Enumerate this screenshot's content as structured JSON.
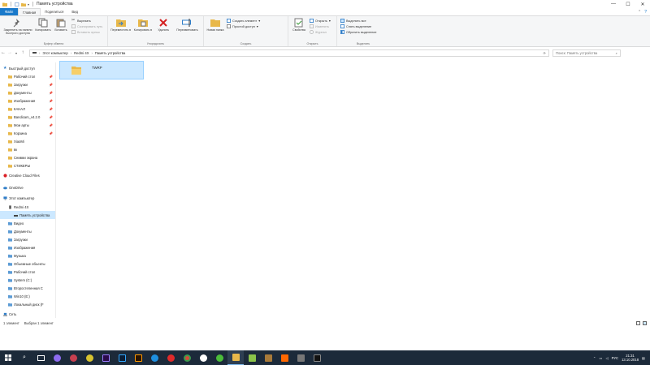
{
  "window": {
    "title": "Память устройства",
    "controls": [
      "—",
      "☐",
      "✕"
    ]
  },
  "ribbon_tabs": {
    "file": "Файл",
    "home": "Главная",
    "share": "Поделиться",
    "view": "Вид"
  },
  "ribbon": {
    "clipboard": {
      "label": "Буфер обмена",
      "pin": "Закрепить на панели быстрого доступа",
      "copy": "Копировать",
      "paste": "Вставить",
      "cut": "Вырезать",
      "copy_path": "Скопировать путь",
      "paste_shortcut": "Вставить ярлык"
    },
    "organize": {
      "label": "Упорядочить",
      "move_to": "Переместить в",
      "copy_to": "Копировать в",
      "delete": "Удалить",
      "rename": "Переименовать"
    },
    "new": {
      "label": "Создать",
      "new_folder": "Новая папка",
      "new_item": "Создать элемент",
      "easy_access": "Простой доступ"
    },
    "open": {
      "label": "Открыть",
      "properties": "Свойства",
      "open": "Открыть",
      "edit": "Изменить",
      "history": "Журнал"
    },
    "select": {
      "label": "Выделить",
      "select_all": "Выделить все",
      "select_none": "Снять выделение",
      "invert": "Обратить выделение"
    }
  },
  "address": {
    "path": [
      "Этот компьютер",
      "Redmi 4X",
      "Память устройства"
    ],
    "search_placeholder": "Поиск: Память устройства"
  },
  "nav": {
    "quick_access": "Быстрый доступ",
    "items": [
      {
        "label": "Рабочий стол",
        "pinned": true
      },
      {
        "label": "Загрузки",
        "pinned": true
      },
      {
        "label": "Документы",
        "pinned": true
      },
      {
        "label": "Изображения",
        "pinned": true
      },
      {
        "label": "КАНАЛ",
        "pinned": true
      },
      {
        "label": "Bandicam_v4.2.0",
        "pinned": true
      },
      {
        "label": "Мои арты",
        "pinned": true
      },
      {
        "label": "Корзина",
        "pinned": true
      },
      {
        "label": "XiaoMi",
        "pinned": false
      },
      {
        "label": "вк",
        "pinned": false
      },
      {
        "label": "Снимки экрана",
        "pinned": false
      },
      {
        "label": "СТИКЕРЫ",
        "pinned": false
      }
    ],
    "creative_cloud": "Creative Cloud Files",
    "onedrive": "OneDrive",
    "this_pc": "Этот компьютер",
    "device": "Redmi 4X",
    "device_storage": "Память устройства",
    "pc_items": [
      "Видео",
      "Документы",
      "Загрузки",
      "Изображения",
      "Музыка",
      "Объемные объекты",
      "Рабочий стол",
      "System (C:)",
      "Второстепенная С",
      "Win10 (E:)",
      "Локальный диск (F"
    ],
    "network": "Сеть"
  },
  "content": {
    "folder_name": "TWRP"
  },
  "status": {
    "count": "1 элемент",
    "selected": "Выбран 1 элемент"
  },
  "tray": {
    "lang": "РУС",
    "time": "21:31",
    "date": "13.10.2018"
  },
  "colors": {
    "file_tab": "#1979ca",
    "selection": "#cce8ff",
    "taskbar": "#1c2a3a",
    "folder": "#e8b84a"
  }
}
